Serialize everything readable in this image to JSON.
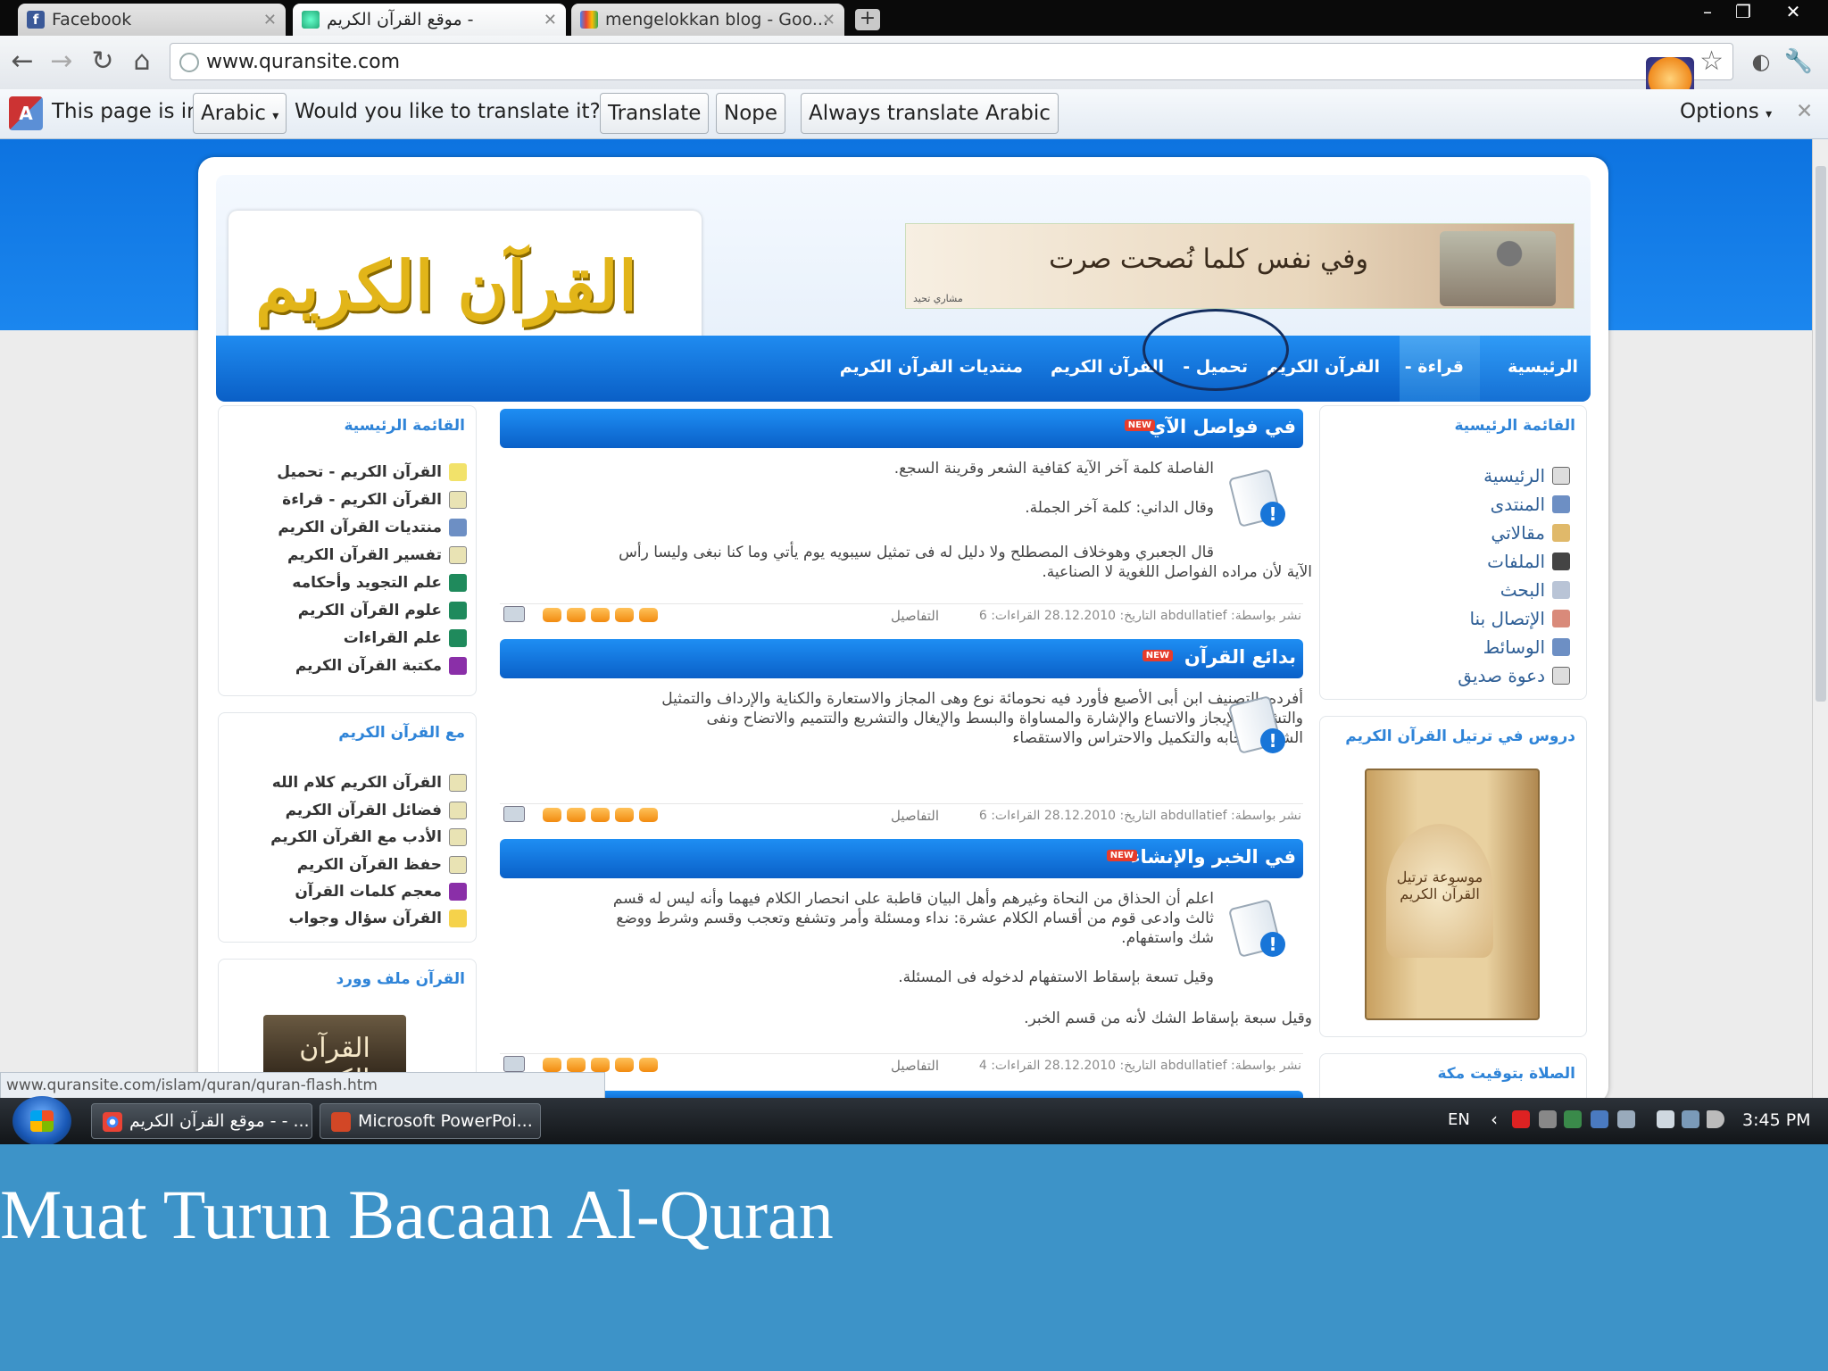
{
  "browser": {
    "tabs": [
      {
        "label": "Facebook",
        "favicon": "facebook-icon"
      },
      {
        "label": "موقع القرآن الكريم -",
        "favicon": "globe-icon"
      },
      {
        "label": "mengelokkan blog - Goo...",
        "favicon": "google-icon"
      }
    ],
    "url": "www.quransite.com"
  },
  "translate_bar": {
    "prefix": "This page is in",
    "language": "Arabic",
    "question": "Would you like to translate it?",
    "translate_label": "Translate",
    "nope_label": "Nope",
    "always_label": "Always translate Arabic",
    "options_label": "Options"
  },
  "site": {
    "logo_text": "القرآن الكريم",
    "banner_text": "وفي نفس كلما نُصحت صرت",
    "banner_sig": "مشاري تحيد",
    "nav": [
      "الرئيسية",
      "- قراءة",
      "القرآن الكريم",
      "- تحميل",
      "القرآن الكريم",
      "منتديات القرآن الكريم"
    ]
  },
  "left_sidebar": {
    "main_title": "القائمة الرئيسية",
    "main_items": [
      {
        "label": "القرآن الكريم - تحميل",
        "icon": "speaker-icon"
      },
      {
        "label": "القرآن الكريم - قراءة",
        "icon": "page-icon"
      },
      {
        "label": "منتديات القرآن الكريم",
        "icon": "grid-icon"
      },
      {
        "label": "تفسير القرآن الكريم",
        "icon": "page-icon"
      },
      {
        "label": "علم التجويد وأحكامه",
        "icon": "book-icon"
      },
      {
        "label": "علوم القرآن الكريم",
        "icon": "book-icon"
      },
      {
        "label": "علم القراءات",
        "icon": "book-icon"
      },
      {
        "label": "مكتبة القرآن الكريم",
        "icon": "purple-book-icon"
      }
    ],
    "with_title": "مع القرآن الكريم",
    "with_items": [
      {
        "label": "القرآن الكريم كلام الله",
        "icon": "page-icon"
      },
      {
        "label": "فضائل القرآن الكريم",
        "icon": "page-icon"
      },
      {
        "label": "الأدب مع القرآن الكريم",
        "icon": "page-icon"
      },
      {
        "label": "حفظ القرآن الكريم",
        "icon": "page-icon"
      },
      {
        "label": "معجم كلمات القرآن",
        "icon": "purple-book-icon"
      },
      {
        "label": "القرآن سؤال وجواب",
        "icon": "bulb-icon"
      }
    ],
    "word_title": "القرآن ملف وورد",
    "word_thumb_text": "القرآن الكريم"
  },
  "right_sidebar": {
    "main_title": "القائمة الرئيسية",
    "items": [
      {
        "label": "الرئيسية",
        "icon": "house-icon"
      },
      {
        "label": "المنتدى",
        "icon": "grid-icon"
      },
      {
        "label": "مقالاتي",
        "icon": "pencil-icon"
      },
      {
        "label": "الملفات",
        "icon": "disk-icon"
      },
      {
        "label": "البحث",
        "icon": "search-icon"
      },
      {
        "label": "الإتصال بنا",
        "icon": "mail-icon"
      },
      {
        "label": "الوسائط",
        "icon": "media-icon"
      },
      {
        "label": "دعوة صديق",
        "icon": "invite-icon"
      }
    ],
    "lessons_title": "دروس في ترتيل القرآن الكريم",
    "book_title": "موسوعة ترتيل القرآن الكريم",
    "prayer_title": "الصلاة بتوقيت مكة"
  },
  "articles": [
    {
      "title": "في فواصل الآي",
      "new": "NEW",
      "lines": [
        "الفاصلة كلمة آخر الآية كقافية الشعر وقرينة السجع.",
        "وقال الداني: كلمة آخر الجملة.",
        "قال الجعبري وهوخلاف المصطلح ولا دليل له فى تمثيل سيبويه يوم يأتي وما كنا نبغى وليسا رأس",
        "الآية لأن مراده الفواصل اللغوية لا الصناعية."
      ],
      "meta": "نشر بواسطة: abdullatief التاريخ: 28.12.2010 القراءات: 6",
      "details": "التفاصيل",
      "rating": 5
    },
    {
      "title": "بدائع القرآن",
      "new": "NEW",
      "lines": [
        "أفرده بالتصنيف ابن أبى الأصبع فأورد فيه نحومائة نوع وهى المجاز والاستعارة والكناية والإرداف والتمثيل",
        "والتشبيه والإيجاز والاتساع والإشارة والمساواة والبسط والإيغال والتشريع والتتميم والاتضاح ونفى",
        "الشيء بإيجابه والتكميل والاحتراس والاستقصاء"
      ],
      "meta": "نشر بواسطة: abdullatief التاريخ: 28.12.2010 القراءات: 6",
      "details": "التفاصيل",
      "rating": 5
    },
    {
      "title": "في الخبر والإنشاء",
      "new": "NEW",
      "lines": [
        "اعلم أن الحذاق من النحاة وغيرهم وأهل البيان قاطبة على انحصار الكلام فيهما وأنه ليس له قسم",
        "ثالث وادعى قوم من أقسام الكلام عشرة: نداء ومسئلة وأمر وتشفع وتعجب وقسم وشرط ووضع",
        "شك واستفهام.",
        "وقيل تسعة بإسقاط الاستفهام لدخوله فى المسئلة.",
        "وقيل سبعة بإسقاط الشك لأنه من قسم الخبر."
      ],
      "meta": "نشر بواسطة: abdullatief التاريخ: 28.12.2010 القراءات: 4",
      "details": "التفاصيل",
      "rating": 5
    }
  ],
  "status_url": "www.quransite.com/islam/quran/quran-flash.htm",
  "taskbar": {
    "tasks": [
      "موقع القرآن الكريم - - ...",
      "Microsoft PowerPoi..."
    ],
    "lang": "EN",
    "clock": "3:45 PM"
  },
  "caption": "Muat Turun Bacaan Al-Quran",
  "colors": {
    "nav_blue": "#0a5fc6",
    "caption_band": "#3d93c8",
    "rating_orange": "#f28b10",
    "link_blue": "#2f84d8"
  }
}
